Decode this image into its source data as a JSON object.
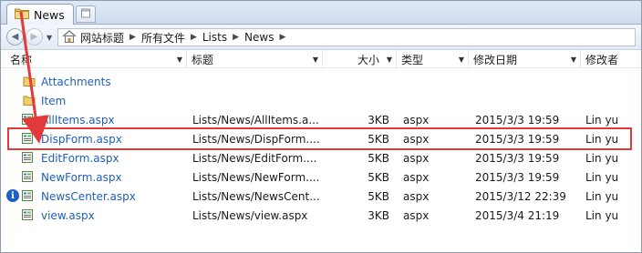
{
  "tab": {
    "label": "News"
  },
  "breadcrumbs": [
    "网站标题",
    "所有文件",
    "Lists",
    "News"
  ],
  "columns": [
    "名称",
    "标题",
    "大小",
    "类型",
    "修改日期",
    "修改者"
  ],
  "rows": [
    {
      "name": "Attachments",
      "kind": "folder",
      "title": "",
      "size": "",
      "type": "",
      "modified": "",
      "by": ""
    },
    {
      "name": "Item",
      "kind": "folder",
      "title": "",
      "size": "",
      "type": "",
      "modified": "",
      "by": ""
    },
    {
      "name": "AllItems.aspx",
      "kind": "file",
      "title": "Lists/News/AllItems.a...",
      "size": "3KB",
      "type": "aspx",
      "modified": "2015/3/3 19:59",
      "by": "Lin yu"
    },
    {
      "name": "DispForm.aspx",
      "kind": "file",
      "title": "Lists/News/DispForm....",
      "size": "5KB",
      "type": "aspx",
      "modified": "2015/3/3 19:59",
      "by": "Lin yu",
      "highlighted": true
    },
    {
      "name": "EditForm.aspx",
      "kind": "file",
      "title": "Lists/News/EditForm....",
      "size": "5KB",
      "type": "aspx",
      "modified": "2015/3/3 19:59",
      "by": "Lin yu"
    },
    {
      "name": "NewForm.aspx",
      "kind": "file",
      "title": "Lists/News/NewForm....",
      "size": "5KB",
      "type": "aspx",
      "modified": "2015/3/3 19:59",
      "by": "Lin yu"
    },
    {
      "name": "NewsCenter.aspx",
      "kind": "file",
      "title": "Lists/News/NewsCent...",
      "size": "5KB",
      "type": "aspx",
      "modified": "2015/3/12 22:39",
      "by": "Lin yu",
      "info": true
    },
    {
      "name": "view.aspx",
      "kind": "file",
      "title": "Lists/News/view.aspx",
      "size": "3KB",
      "type": "aspx",
      "modified": "2015/3/4 21:19",
      "by": "Lin yu"
    }
  ],
  "colors": {
    "link": "#1f5fb8",
    "highlight": "#e23a3a"
  }
}
